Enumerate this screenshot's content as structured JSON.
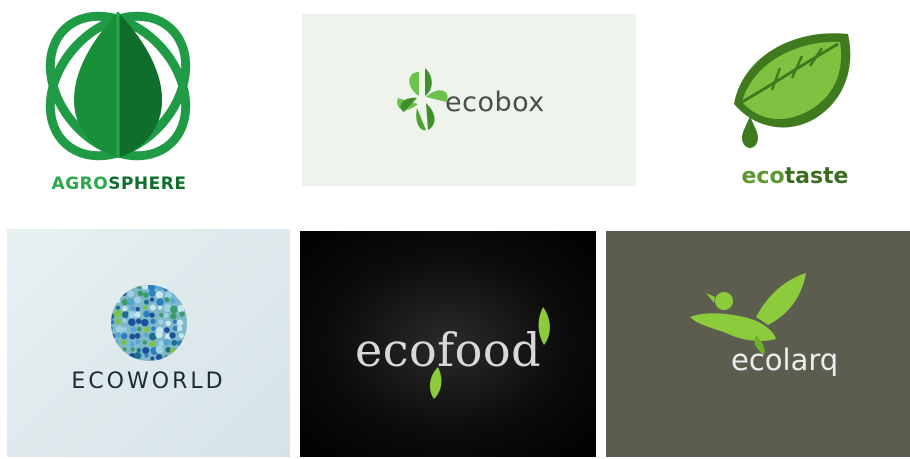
{
  "logos": [
    {
      "id": "agrosphere",
      "text_a": "AGRO",
      "text_b": "SPHERE",
      "colors": {
        "primary": "#1a8f3a",
        "dark": "#0f6e2c",
        "accent": "#2aa84a"
      },
      "icon": "leaf-orbit-icon"
    },
    {
      "id": "ecobox",
      "text": "ecobox",
      "colors": {
        "leaf": "#5db83a",
        "text": "#4a4f4a",
        "background": "#eef3ec"
      },
      "icon": "pinwheel-leaf-icon"
    },
    {
      "id": "ecotaste",
      "text_a": "eco",
      "text_b": "taste",
      "colors": {
        "leaf": "#7fc241",
        "dark": "#3f7a1e",
        "text_a": "#5a9a2e",
        "text_b": "#3d6b20"
      },
      "icon": "leaf-drop-icon"
    },
    {
      "id": "ecoworld",
      "text": "ECOWORLD",
      "colors": {
        "text": "#1c2a33"
      },
      "icon": "dotted-globe-icon"
    },
    {
      "id": "ecofood",
      "text": "ecofood",
      "colors": {
        "text": "#d8d8d8",
        "leaf": "#8ccc3c"
      },
      "icon": "leaf-sprout-icon"
    },
    {
      "id": "ecolarq",
      "text": "ecolarq",
      "colors": {
        "bird": "#8ccc3c",
        "text": "#ececec",
        "background": "#5c5c4f"
      },
      "icon": "bird-icon"
    }
  ]
}
